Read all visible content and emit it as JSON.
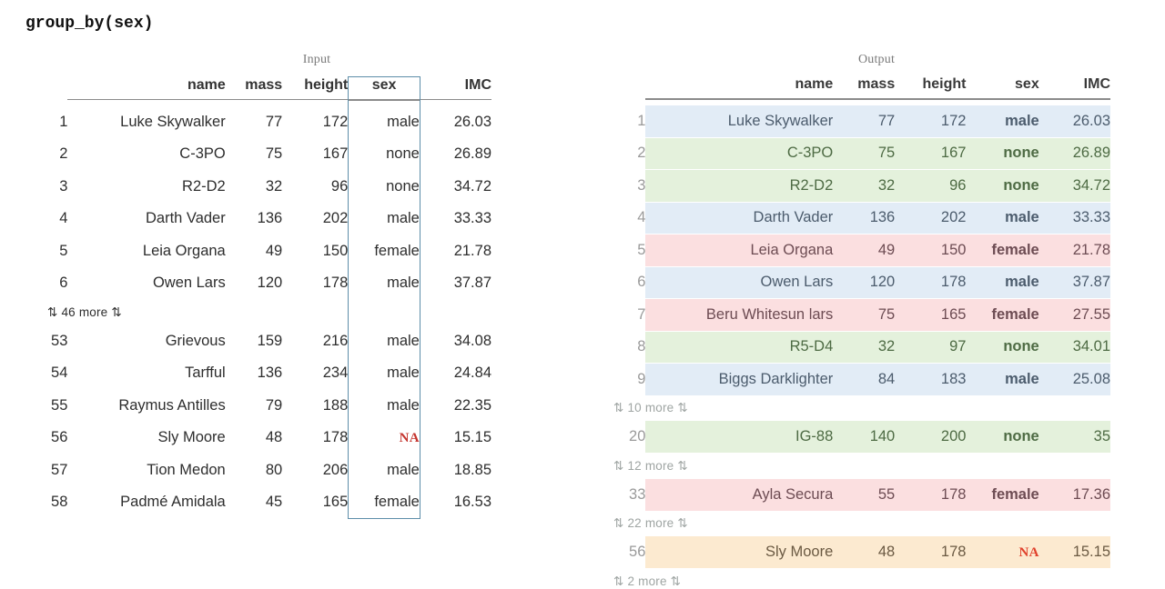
{
  "title": "group_by(sex)",
  "colors": {
    "group_blue": "#e2ecf6",
    "group_green": "#e4f1dc",
    "group_pink": "#fbdfe0",
    "group_orange": "#fcead0",
    "highlight_border": "#5d8ea9",
    "na_input": "#c4342e",
    "na_output": "#e0402b",
    "rownum": "#9a9a9a",
    "more_text": "#9fa5a3"
  },
  "input": {
    "caption": "Input",
    "columns": [
      "name",
      "mass",
      "height",
      "sex",
      "IMC"
    ],
    "highlighted_column": "sex",
    "rows": [
      {
        "n": "1",
        "name": "Luke Skywalker",
        "mass": "77",
        "height": "172",
        "sex": "male",
        "imc": "26.03"
      },
      {
        "n": "2",
        "name": "C-3PO",
        "mass": "75",
        "height": "167",
        "sex": "none",
        "imc": "26.89"
      },
      {
        "n": "3",
        "name": "R2-D2",
        "mass": "32",
        "height": "96",
        "sex": "none",
        "imc": "34.72"
      },
      {
        "n": "4",
        "name": "Darth Vader",
        "mass": "136",
        "height": "202",
        "sex": "male",
        "imc": "33.33"
      },
      {
        "n": "5",
        "name": "Leia Organa",
        "mass": "49",
        "height": "150",
        "sex": "female",
        "imc": "21.78"
      },
      {
        "n": "6",
        "name": "Owen Lars",
        "mass": "120",
        "height": "178",
        "sex": "male",
        "imc": "37.87"
      }
    ],
    "more_label": "⇅ 46 more ⇅",
    "rows_tail": [
      {
        "n": "53",
        "name": "Grievous",
        "mass": "159",
        "height": "216",
        "sex": "male",
        "imc": "34.08"
      },
      {
        "n": "54",
        "name": "Tarfful",
        "mass": "136",
        "height": "234",
        "sex": "male",
        "imc": "24.84"
      },
      {
        "n": "55",
        "name": "Raymus Antilles",
        "mass": "79",
        "height": "188",
        "sex": "male",
        "imc": "22.35"
      },
      {
        "n": "56",
        "name": "Sly Moore",
        "mass": "48",
        "height": "178",
        "sex": "NA",
        "imc": "15.15",
        "sex_na": true
      },
      {
        "n": "57",
        "name": "Tion Medon",
        "mass": "80",
        "height": "206",
        "sex": "male",
        "imc": "18.85"
      },
      {
        "n": "58",
        "name": "Padmé Amidala",
        "mass": "45",
        "height": "165",
        "sex": "female",
        "imc": "16.53"
      }
    ]
  },
  "output": {
    "caption": "Output",
    "columns": [
      "name",
      "mass",
      "height",
      "sex",
      "IMC"
    ],
    "rows": [
      {
        "kind": "data",
        "group": "blue",
        "n": "1",
        "name": "Luke Skywalker",
        "mass": "77",
        "height": "172",
        "sex": "male",
        "imc": "26.03"
      },
      {
        "kind": "data",
        "group": "green",
        "n": "2",
        "name": "C-3PO",
        "mass": "75",
        "height": "167",
        "sex": "none",
        "imc": "26.89"
      },
      {
        "kind": "data",
        "group": "green",
        "n": "3",
        "name": "R2-D2",
        "mass": "32",
        "height": "96",
        "sex": "none",
        "imc": "34.72"
      },
      {
        "kind": "data",
        "group": "blue",
        "n": "4",
        "name": "Darth Vader",
        "mass": "136",
        "height": "202",
        "sex": "male",
        "imc": "33.33"
      },
      {
        "kind": "data",
        "group": "pink",
        "n": "5",
        "name": "Leia Organa",
        "mass": "49",
        "height": "150",
        "sex": "female",
        "imc": "21.78"
      },
      {
        "kind": "data",
        "group": "blue",
        "n": "6",
        "name": "Owen Lars",
        "mass": "120",
        "height": "178",
        "sex": "male",
        "imc": "37.87"
      },
      {
        "kind": "data",
        "group": "pink",
        "n": "7",
        "name": "Beru Whitesun lars",
        "mass": "75",
        "height": "165",
        "sex": "female",
        "imc": "27.55"
      },
      {
        "kind": "data",
        "group": "green",
        "n": "8",
        "name": "R5-D4",
        "mass": "32",
        "height": "97",
        "sex": "none",
        "imc": "34.01"
      },
      {
        "kind": "data",
        "group": "blue",
        "n": "9",
        "name": "Biggs Darklighter",
        "mass": "84",
        "height": "183",
        "sex": "male",
        "imc": "25.08"
      },
      {
        "kind": "more",
        "label": "⇅ 10 more ⇅"
      },
      {
        "kind": "data",
        "group": "green",
        "n": "20",
        "name": "IG-88",
        "mass": "140",
        "height": "200",
        "sex": "none",
        "imc": "35"
      },
      {
        "kind": "more",
        "label": "⇅ 12 more ⇅"
      },
      {
        "kind": "data",
        "group": "pink",
        "n": "33",
        "name": "Ayla Secura",
        "mass": "55",
        "height": "178",
        "sex": "female",
        "imc": "17.36"
      },
      {
        "kind": "more",
        "label": "⇅ 22 more ⇅"
      },
      {
        "kind": "data",
        "group": "orange",
        "n": "56",
        "name": "Sly Moore",
        "mass": "48",
        "height": "178",
        "sex": "NA",
        "imc": "15.15",
        "sex_na": true
      },
      {
        "kind": "more",
        "label": "⇅ 2 more ⇅"
      }
    ]
  }
}
